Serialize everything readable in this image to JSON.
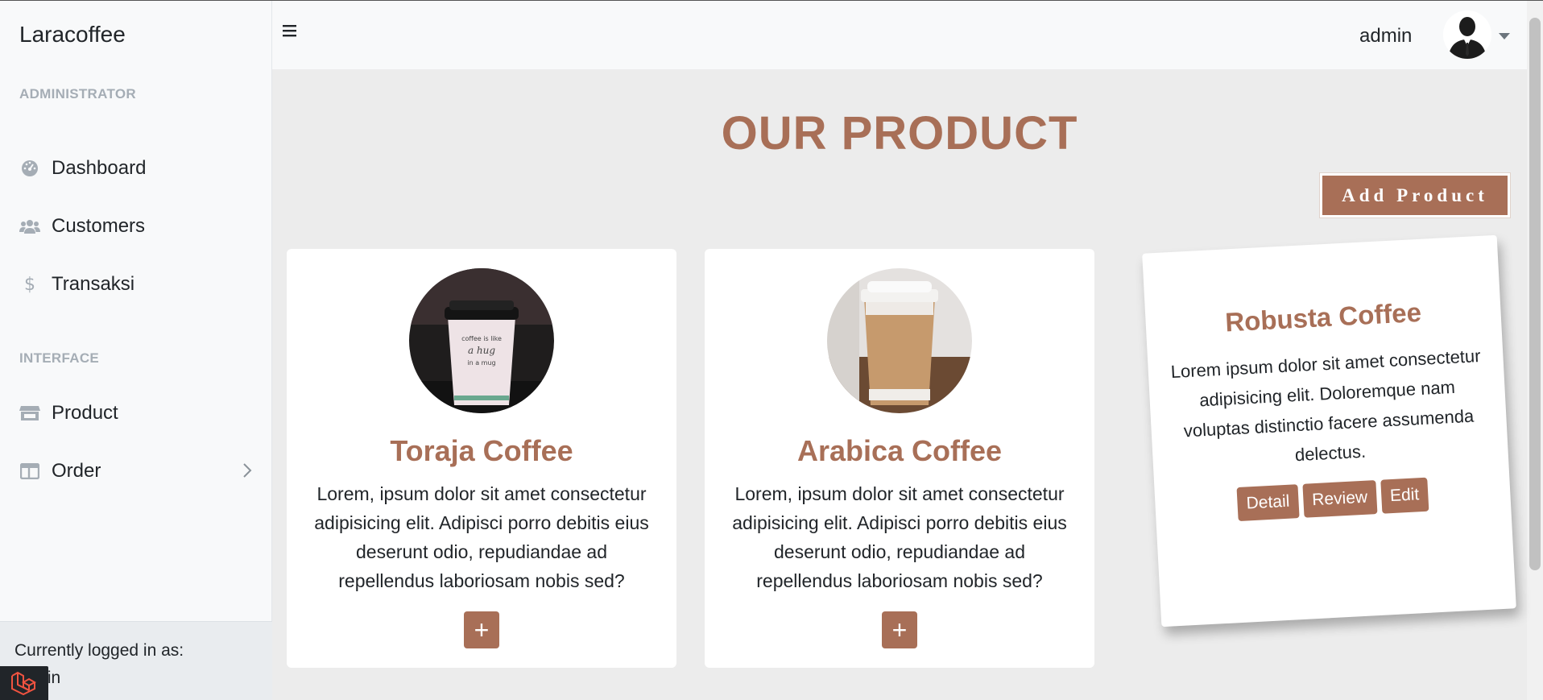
{
  "sidebar": {
    "brand": "Laracoffee",
    "heading_admin": "ADMINISTRATOR",
    "heading_interface": "INTERFACE",
    "items": [
      {
        "label": "Dashboard",
        "icon": "gauge-icon"
      },
      {
        "label": "Customers",
        "icon": "users-icon"
      },
      {
        "label": "Transaksi",
        "icon": "dollar-icon"
      },
      {
        "label": "Product",
        "icon": "store-icon"
      },
      {
        "label": "Order",
        "icon": "columns-icon"
      }
    ],
    "footer_label": "Currently logged in as:",
    "footer_user": "admin"
  },
  "topbar": {
    "username": "admin"
  },
  "main": {
    "title": "OUR PRODUCT",
    "add_button": "Add Product",
    "products": [
      {
        "name": "Toraja Coffee",
        "desc": "Lorem, ipsum dolor sit amet consectetur adipisicing elit. Adipisci porro debitis eius deserunt odio, repudiandae ad repellendus laboriosam nobis sed?",
        "action": "+"
      },
      {
        "name": "Arabica Coffee",
        "desc": "Lorem, ipsum dolor sit amet consectetur adipisicing elit. Adipisci porro debitis eius deserunt odio, repudiandae ad repellendus laboriosam nobis sed?",
        "action": "+"
      }
    ],
    "featured": {
      "name": "Robusta Coffee",
      "desc": "Lorem ipsum dolor sit amet consectetur adipisicing elit. Doloremque nam voluptas distinctio facere assumenda delectus.",
      "buttons": [
        "Detail",
        "Review",
        "Edit"
      ]
    }
  },
  "colors": {
    "accent": "#a86f57",
    "sidebar_bg": "#f8f9fa",
    "main_bg": "#ececec",
    "muted": "#a5adb5"
  }
}
